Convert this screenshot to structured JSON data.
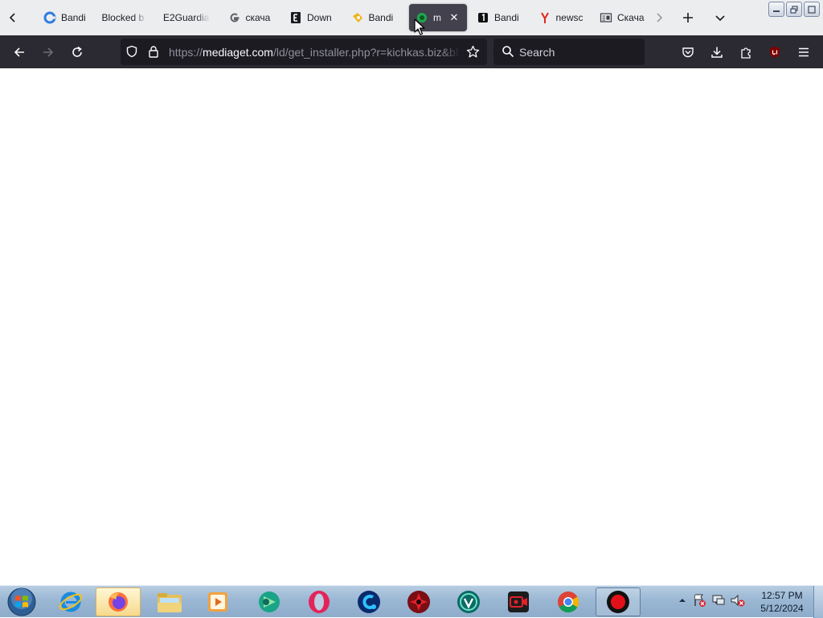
{
  "tabs": [
    {
      "title": "Bandi",
      "icon": "edge-ring-icon"
    },
    {
      "title": "Blocked b",
      "icon": "none"
    },
    {
      "title": "E2Guardia",
      "icon": "none"
    },
    {
      "title": "скача",
      "icon": "google-g-icon"
    },
    {
      "title": "Down",
      "icon": "e-square-icon"
    },
    {
      "title": "Bandi",
      "icon": "bandicam-icon"
    },
    {
      "title": "m",
      "icon": "mediaget-icon",
      "active": true
    },
    {
      "title": "Bandi",
      "icon": "number-one-icon"
    },
    {
      "title": "newsc",
      "icon": "yandex-y-icon"
    },
    {
      "title": "Скача",
      "icon": "page-icon"
    }
  ],
  "active_close_glyph": "✕",
  "address": {
    "scheme": "https://",
    "host": "mediaget.com",
    "path": "/ld/get_installer.php?r=kichkas.biz&bb"
  },
  "search": {
    "placeholder": "Search"
  },
  "clock": {
    "time": "12:57 PM",
    "date": "5/12/2024"
  },
  "taskbar_apps": [
    "internet-explorer-icon",
    "firefox-icon",
    "file-explorer-icon",
    "media-player-icon",
    "green-app-icon",
    "opera-icon",
    "ccleaner-icon",
    "red-game-icon",
    "teal-shield-icon",
    "screen-recorder-icon",
    "chrome-icon",
    "record-button-icon"
  ],
  "colors": {
    "tab_active": "#42414d",
    "toolbar": "#2b2a33",
    "field": "#1c1b22"
  }
}
